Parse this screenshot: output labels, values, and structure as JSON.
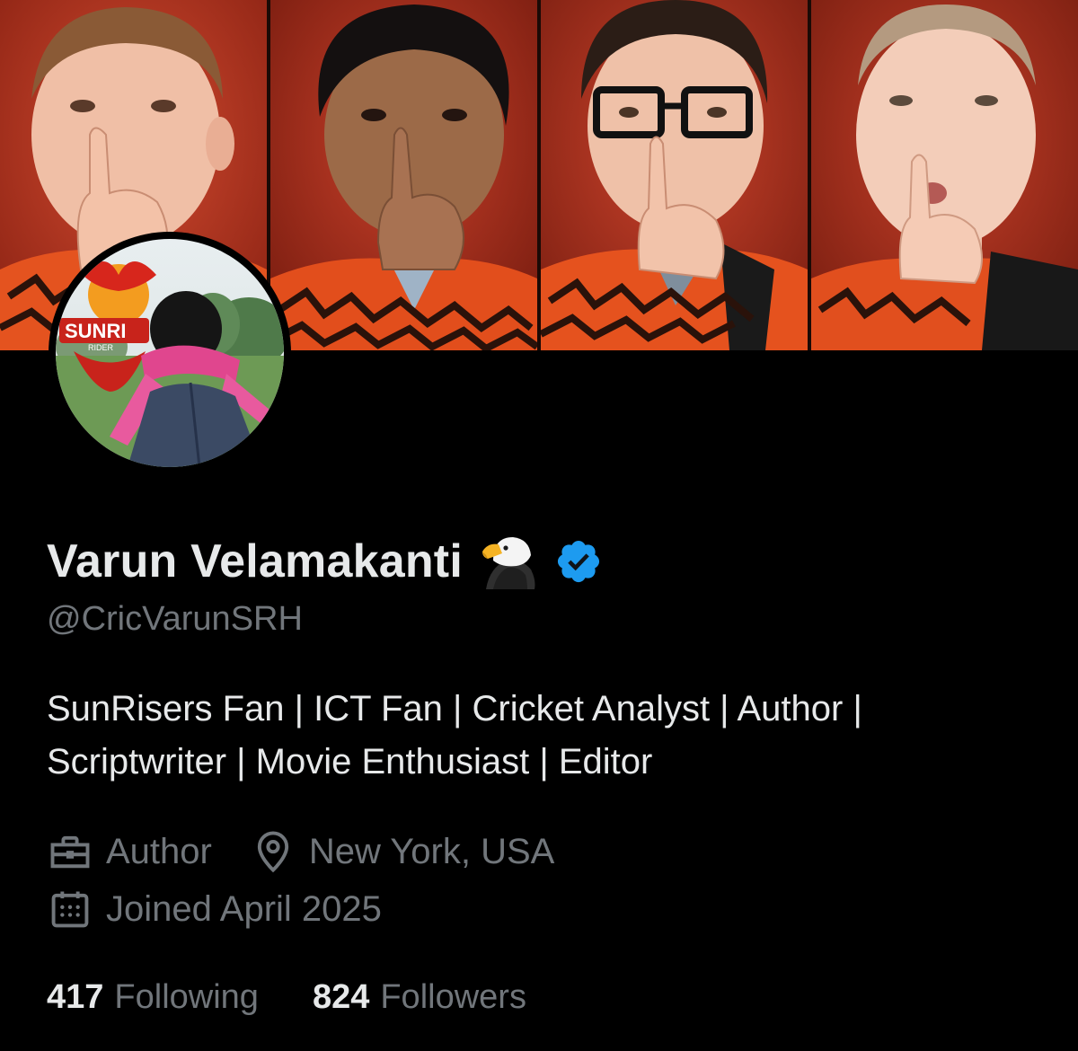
{
  "profile": {
    "display_name": "Varun Velamakanti",
    "handle": "@CricVarunSRH",
    "bio_line1": "SunRisers Fan | ICT Fan | Cricket Analyst | Author |",
    "bio_line2": "Scriptwriter | Movie Enthusiast | Editor",
    "profession": "Author",
    "location": "New York, USA",
    "joined": "Joined April 2025",
    "verified": true,
    "badge_icon": "eagle-emoji"
  },
  "avatar": {
    "logo_text": "SUNRI",
    "logo_subtext": "RIDER"
  },
  "stats": {
    "following_count": "417",
    "following_label": "Following",
    "followers_count": "824",
    "followers_label": "Followers"
  },
  "icons": {
    "profession": "briefcase-icon",
    "location": "location-pin-icon",
    "joined": "calendar-icon",
    "verified": "verified-badge-icon"
  },
  "colors": {
    "background": "#000000",
    "primary_text": "#e7e9ea",
    "secondary_text": "#71767b",
    "verified_blue": "#1d9bf0",
    "banner_red": "#b5321f",
    "jersey_orange": "#e4531f"
  }
}
